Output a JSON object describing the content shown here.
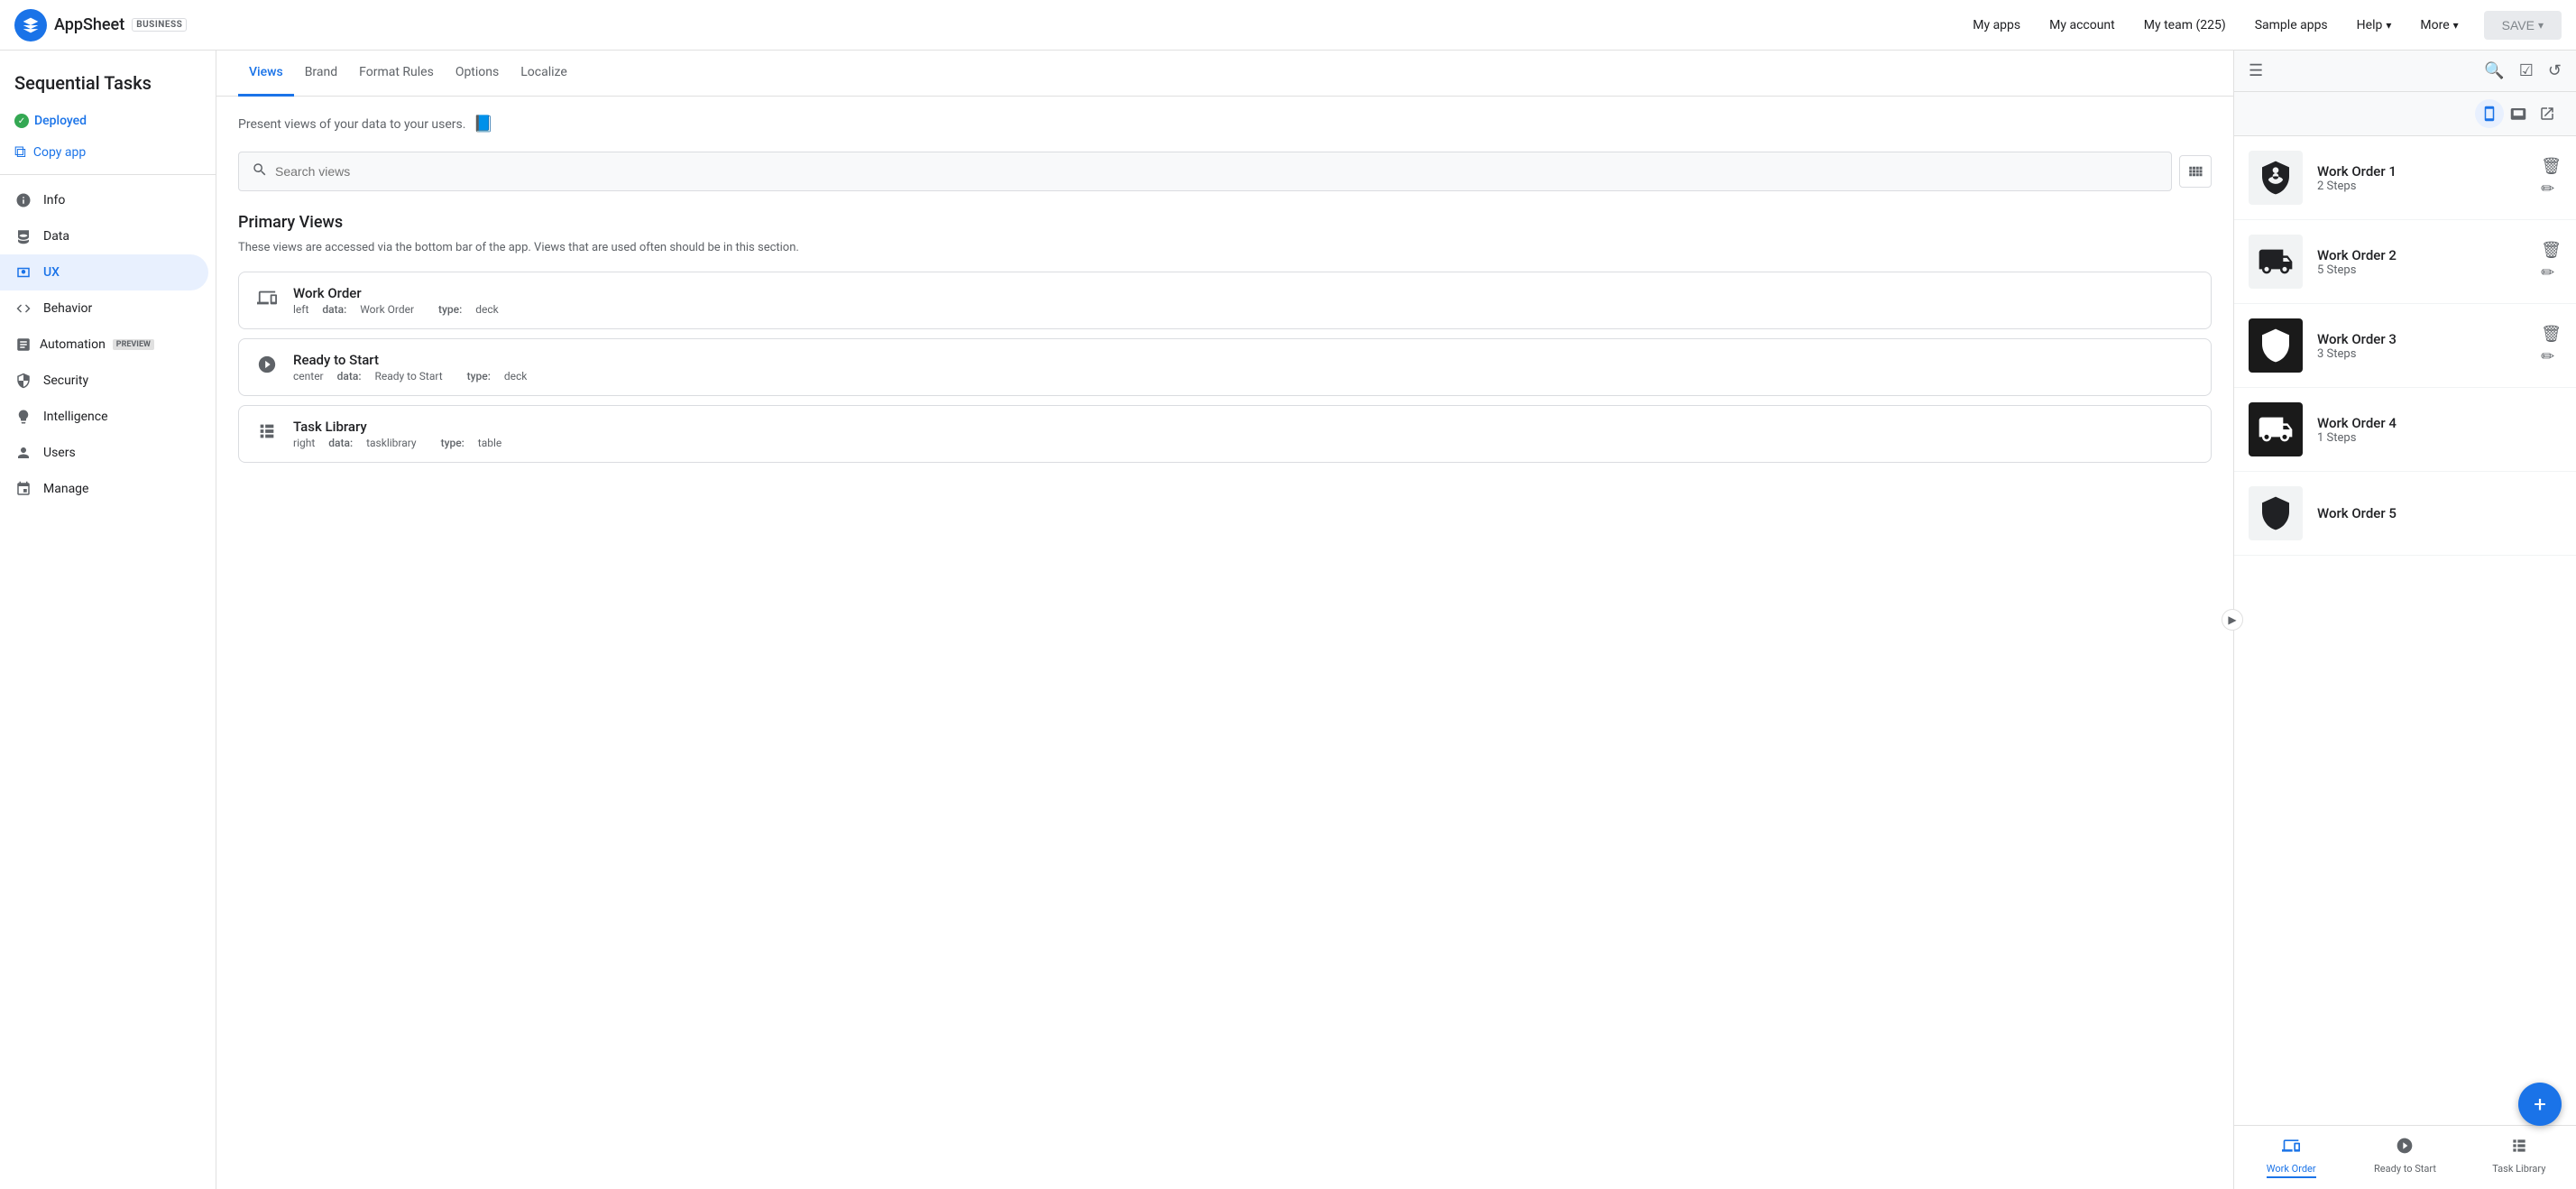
{
  "app": {
    "logo_text": "AppSheet",
    "logo_badge": "BUSINESS",
    "title": "Sequential Tasks"
  },
  "top_nav": {
    "links": [
      {
        "id": "my-apps",
        "label": "My apps",
        "has_dropdown": false
      },
      {
        "id": "my-account",
        "label": "My account",
        "has_dropdown": false
      },
      {
        "id": "my-team",
        "label": "My team (225)",
        "has_dropdown": false
      },
      {
        "id": "sample-apps",
        "label": "Sample apps",
        "has_dropdown": false
      },
      {
        "id": "help",
        "label": "Help",
        "has_dropdown": true
      },
      {
        "id": "more",
        "label": "More",
        "has_dropdown": true
      }
    ],
    "save_label": "SAVE"
  },
  "sidebar": {
    "status": "Deployed",
    "copy_label": "Copy app",
    "items": [
      {
        "id": "info",
        "label": "Info",
        "icon": "info"
      },
      {
        "id": "data",
        "label": "Data",
        "icon": "data"
      },
      {
        "id": "ux",
        "label": "UX",
        "icon": "ux",
        "active": true
      },
      {
        "id": "behavior",
        "label": "Behavior",
        "icon": "behavior"
      },
      {
        "id": "automation",
        "label": "Automation",
        "badge": "PREVIEW",
        "icon": "automation"
      },
      {
        "id": "security",
        "label": "Security",
        "icon": "security"
      },
      {
        "id": "intelligence",
        "label": "Intelligence",
        "icon": "intelligence"
      },
      {
        "id": "users",
        "label": "Users",
        "icon": "users"
      },
      {
        "id": "manage",
        "label": "Manage",
        "icon": "manage"
      }
    ]
  },
  "tabs": [
    {
      "id": "views",
      "label": "Views",
      "active": true
    },
    {
      "id": "brand",
      "label": "Brand"
    },
    {
      "id": "format-rules",
      "label": "Format Rules"
    },
    {
      "id": "options",
      "label": "Options"
    },
    {
      "id": "localize",
      "label": "Localize"
    }
  ],
  "content": {
    "description": "Present views of your data to your users.",
    "search_placeholder": "Search views",
    "primary_views": {
      "title": "Primary Views",
      "subtitle": "These views are accessed via the bottom bar of the app. Views that are used often should be in this section.",
      "views": [
        {
          "id": "work-order",
          "name": "Work Order",
          "position": "left",
          "data": "Work Order",
          "type": "deck",
          "icon": "deck"
        },
        {
          "id": "ready-to-start",
          "name": "Ready to Start",
          "position": "center",
          "data": "Ready to Start",
          "type": "deck",
          "icon": "play"
        },
        {
          "id": "task-library",
          "name": "Task Library",
          "position": "right",
          "data": "tasklibrary",
          "type": "table",
          "icon": "table"
        }
      ]
    }
  },
  "preview": {
    "work_orders": [
      {
        "id": 1,
        "name": "Work Order 1",
        "steps": "2 Steps",
        "icon_type": "helmet"
      },
      {
        "id": 2,
        "name": "Work Order 2",
        "steps": "5 Steps",
        "icon_type": "truck"
      },
      {
        "id": 3,
        "name": "Work Order 3",
        "steps": "3 Steps",
        "icon_type": "helmet2"
      },
      {
        "id": 4,
        "name": "Work Order 4",
        "steps": "1 Steps",
        "icon_type": "truck2"
      },
      {
        "id": 5,
        "name": "Work Order 5",
        "steps": "",
        "icon_type": "helmet3"
      }
    ],
    "bottom_nav": [
      {
        "id": "work-order",
        "label": "Work Order",
        "active": true
      },
      {
        "id": "ready-to-start",
        "label": "Ready to Start",
        "active": false
      },
      {
        "id": "task-library",
        "label": "Task Library",
        "active": false
      }
    ]
  }
}
